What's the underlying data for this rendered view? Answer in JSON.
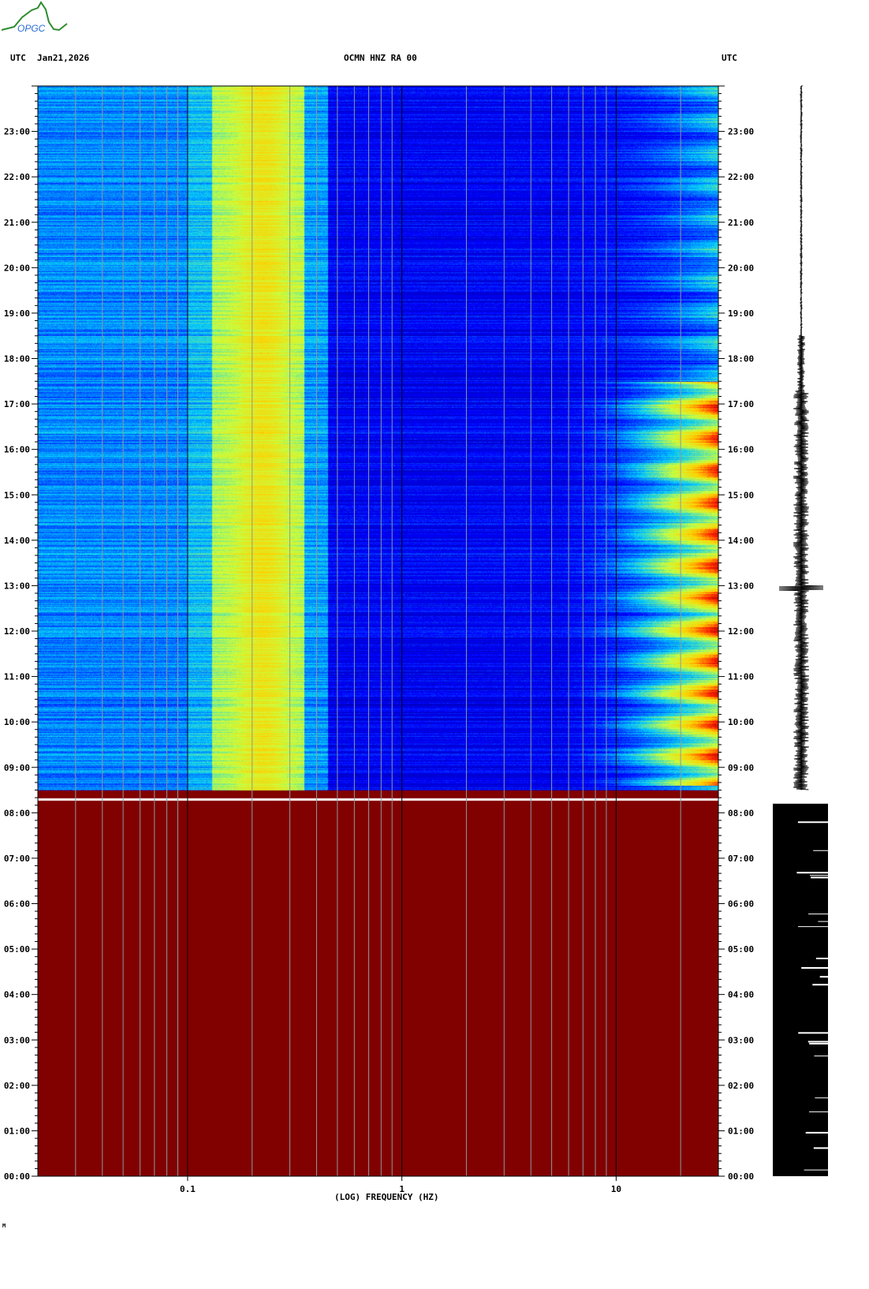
{
  "header": {
    "tz_left": "UTC",
    "date": "Jan21,2026",
    "station": "OCMN HNZ RA 00",
    "tz_right": "UTC"
  },
  "logo": {
    "text": "OPGC"
  },
  "footer_mark": "M",
  "chart_data": {
    "type": "heatmap",
    "title": "OCMN HNZ RA 00",
    "xlabel": "(LOG) FREQUENCY (HZ)",
    "ylabel": "UTC",
    "x_scale": "log",
    "xlim": [
      0.02,
      30
    ],
    "ylim_hours": [
      0,
      24
    ],
    "x_ticks": [
      {
        "value": 0.1,
        "label": "0.1"
      },
      {
        "value": 1,
        "label": "1"
      },
      {
        "value": 10,
        "label": "10"
      }
    ],
    "x_minor_grid": [
      0.03,
      0.04,
      0.05,
      0.06,
      0.07,
      0.08,
      0.09,
      0.2,
      0.3,
      0.4,
      0.5,
      0.6,
      0.7,
      0.8,
      0.9,
      2,
      3,
      4,
      5,
      6,
      7,
      8,
      9,
      20
    ],
    "y_ticks": [
      "00:00",
      "01:00",
      "02:00",
      "03:00",
      "04:00",
      "05:00",
      "06:00",
      "07:00",
      "08:00",
      "09:00",
      "10:00",
      "11:00",
      "12:00",
      "13:00",
      "14:00",
      "15:00",
      "16:00",
      "17:00",
      "18:00",
      "19:00",
      "20:00",
      "21:00",
      "22:00",
      "23:00"
    ],
    "colormap": [
      "#00008b",
      "#0000ff",
      "#00c8ff",
      "#c8ff40",
      "#ffd000",
      "#ff2000",
      "#800000"
    ],
    "saturated_until_hour": 8.5,
    "microseism_band_hz": [
      0.13,
      0.35
    ],
    "high_freq_activity_hours": [
      8.6,
      17.5
    ],
    "high_freq_activity_min_hz": 5
  },
  "colors": {
    "saturated": "#800000",
    "grid": "#8a9aa0",
    "major_grid": "#000000"
  }
}
